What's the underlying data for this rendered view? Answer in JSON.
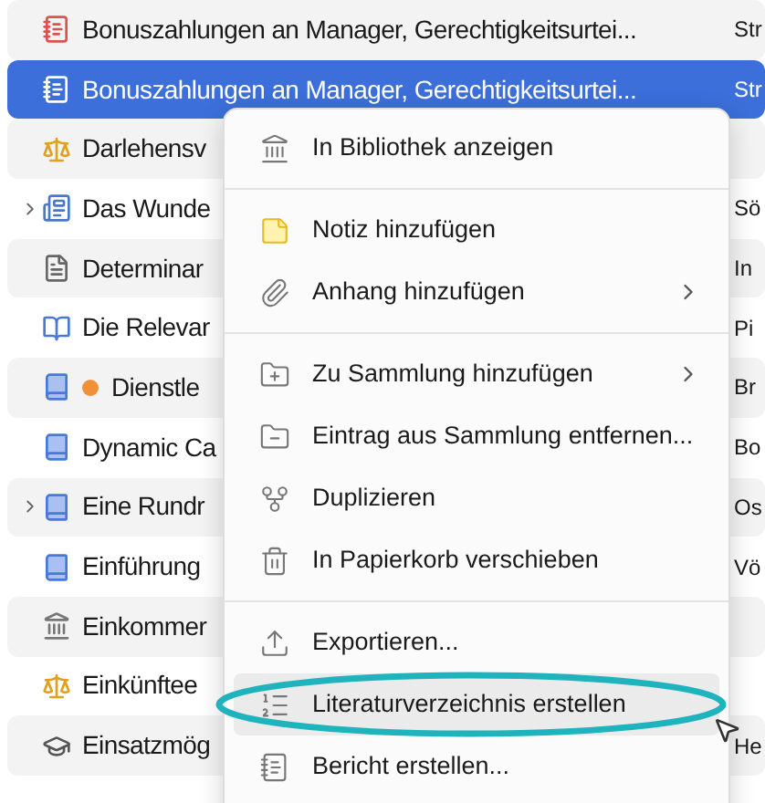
{
  "rows": [
    {
      "title": "Bonuszahlungen an Manager, Gerechtigkeitsurtei...",
      "creator": "Str",
      "kind": "report",
      "has_children": false,
      "selected": false
    },
    {
      "title": "Bonuszahlungen an Manager, Gerechtigkeitsurtei...",
      "creator": "Str",
      "kind": "report",
      "has_children": false,
      "selected": true
    },
    {
      "title": "Darlehensv",
      "kind": "case",
      "has_children": false,
      "selected": false
    },
    {
      "title": "Das Wunde",
      "creator": "Sö",
      "kind": "newspaper",
      "has_children": true,
      "selected": false
    },
    {
      "title": "Determinar",
      "creator": "In",
      "kind": "document",
      "has_children": false,
      "selected": false
    },
    {
      "title": "Die Relevar",
      "creator": "Pi",
      "kind": "book-section",
      "has_children": false,
      "selected": false
    },
    {
      "title": "Dienstle",
      "creator": "Br",
      "kind": "book",
      "has_children": false,
      "selected": false,
      "color": "#f0913a"
    },
    {
      "title": "Dynamic Ca",
      "creator": "Bo",
      "kind": "book",
      "has_children": false,
      "selected": false
    },
    {
      "title": "Eine Rundr",
      "creator": "Os",
      "kind": "book",
      "has_children": true,
      "selected": false
    },
    {
      "title": "Einführung",
      "creator": "Vö",
      "kind": "book",
      "has_children": false,
      "selected": false
    },
    {
      "title": "Einkommer",
      "kind": "statute",
      "has_children": false,
      "selected": false
    },
    {
      "title": "Einkünftee",
      "kind": "case",
      "has_children": false,
      "selected": false
    },
    {
      "title": "Einsatzmög",
      "creator": "He",
      "kind": "thesis",
      "has_children": false,
      "selected": false
    }
  ],
  "context_menu": {
    "items": [
      {
        "kind": "library",
        "label": "In Bibliothek anzeigen",
        "submenu": false,
        "selected": false,
        "circled": false
      },
      {
        "kind": "separator"
      },
      {
        "kind": "note",
        "label": "Notiz hinzufügen",
        "submenu": false,
        "selected": false,
        "circled": false
      },
      {
        "kind": "attachment",
        "label": "Anhang hinzufügen",
        "submenu": true,
        "selected": false,
        "circled": false
      },
      {
        "kind": "separator"
      },
      {
        "kind": "folder-add",
        "label": "Zu Sammlung hinzufügen",
        "submenu": true,
        "selected": false,
        "circled": false
      },
      {
        "kind": "folder-remove",
        "label": "Eintrag aus Sammlung entfernen...",
        "submenu": false,
        "selected": false,
        "circled": false
      },
      {
        "kind": "duplicate",
        "label": "Duplizieren",
        "submenu": false,
        "selected": false,
        "circled": false
      },
      {
        "kind": "trash",
        "label": "In Papierkorb verschieben",
        "submenu": false,
        "selected": false,
        "circled": false
      },
      {
        "kind": "separator"
      },
      {
        "kind": "export",
        "label": "Exportieren...",
        "submenu": false,
        "selected": false,
        "circled": false
      },
      {
        "kind": "bibliography",
        "label": "Literaturverzeichnis erstellen",
        "submenu": false,
        "selected": true,
        "circled": true
      },
      {
        "kind": "report",
        "label": "Bericht erstellen...",
        "submenu": false,
        "selected": false,
        "circled": false
      }
    ]
  }
}
